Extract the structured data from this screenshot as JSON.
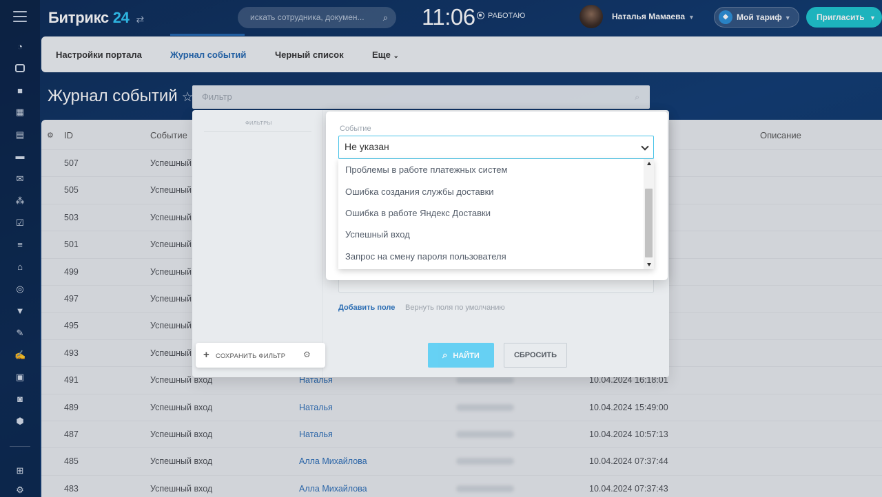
{
  "header": {
    "logo_text": "Битрикс",
    "logo_num": "24",
    "search_placeholder": "искать сотрудника, докумен...",
    "clock": "11:06",
    "status": "РАБОТАЮ",
    "user_name": "Наталья Мамаева",
    "tariff_label": "Мой тариф",
    "invite_label": "Пригласить"
  },
  "tabs": [
    {
      "label": "Настройки портала"
    },
    {
      "label": "Журнал событий"
    },
    {
      "label": "Черный список"
    },
    {
      "label": "Еще"
    }
  ],
  "page": {
    "title": "Журнал событий",
    "filter_placeholder": "Фильтр"
  },
  "grid": {
    "headers": [
      "ID",
      "Событие",
      "Описание"
    ],
    "rows": [
      {
        "id": "507",
        "event": "Успешный вход",
        "user": "",
        "time": ""
      },
      {
        "id": "505",
        "event": "Успешный вход",
        "user": "",
        "time": ""
      },
      {
        "id": "503",
        "event": "Успешный вход",
        "user": "",
        "time": ""
      },
      {
        "id": "501",
        "event": "Успешный вход",
        "user": "",
        "time": ""
      },
      {
        "id": "499",
        "event": "Успешный вход",
        "user": "",
        "time": ""
      },
      {
        "id": "497",
        "event": "Успешный вход",
        "user": "",
        "time": ""
      },
      {
        "id": "495",
        "event": "Успешный вход",
        "user": "",
        "time": ""
      },
      {
        "id": "493",
        "event": "Успешный вход",
        "user": "",
        "time": ""
      },
      {
        "id": "491",
        "event": "Успешный вход",
        "user": "Наталья",
        "time": "10.04.2024 16:18:01"
      },
      {
        "id": "489",
        "event": "Успешный вход",
        "user": "Наталья",
        "time": "10.04.2024 15:49:00"
      },
      {
        "id": "487",
        "event": "Успешный вход",
        "user": "Наталья",
        "time": "10.04.2024 10:57:13"
      },
      {
        "id": "485",
        "event": "Успешный вход",
        "user": "Алла Михайлова",
        "time": "10.04.2024 07:37:44"
      },
      {
        "id": "483",
        "event": "Успешный вход",
        "user": "Алла Михайлова",
        "time": "10.04.2024 07:37:43"
      }
    ]
  },
  "filter_panel": {
    "presets_label": "ФИЛЬТРЫ",
    "add_field": "Добавить поле",
    "restore_fields": "Вернуть поля по умолчанию",
    "find_label": "НАЙТИ",
    "reset_label": "СБРОСИТЬ",
    "save_filter_label": "СОХРАНИТЬ ФИЛЬТР"
  },
  "event_select": {
    "label": "Событие",
    "selected": "Не указан",
    "options": [
      "Проблемы в работе платежных систем",
      "Ошибка создания службы доставки",
      "Ошибка в работе Яндекс Доставки",
      "Успешный вход",
      "Запрос на смену пароля пользователя"
    ]
  },
  "colors": {
    "accent": "#2066b0",
    "cyan": "#2fc6f6",
    "find_button": "#3bc8f5",
    "invite_button": "#1cc7d0"
  }
}
